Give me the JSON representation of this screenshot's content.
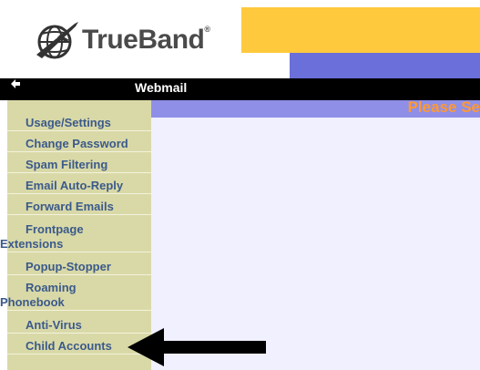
{
  "brand": {
    "name": "TrueBand",
    "reg": "®"
  },
  "header": {
    "section_title": "Webmail",
    "back_icon": "arrow-left-icon",
    "content_heading": "Please Se"
  },
  "colors": {
    "yellow_band": "#ffc93d",
    "purple_band": "#6a6fd9",
    "sidebar_bg": "#d9d9a8",
    "menu_text": "#3b5a8a",
    "content_bg": "#f0f0ff",
    "content_header": "#8f8fe8",
    "heading_text": "#ff9933"
  },
  "sidebar": {
    "items": [
      {
        "label": "Usage/Settings"
      },
      {
        "label": "Change Password"
      },
      {
        "label": "Spam Filtering"
      },
      {
        "label": "Email Auto-Reply"
      },
      {
        "label": "Forward Emails"
      },
      {
        "line1": "Frontpage",
        "line2": "Extensions"
      },
      {
        "label": "Popup-Stopper"
      },
      {
        "line1": "Roaming",
        "line2": "Phonebook"
      },
      {
        "label": "Anti-Virus"
      },
      {
        "label": "Child Accounts"
      }
    ]
  },
  "annotation": {
    "pointer": "arrow-left-icon"
  }
}
